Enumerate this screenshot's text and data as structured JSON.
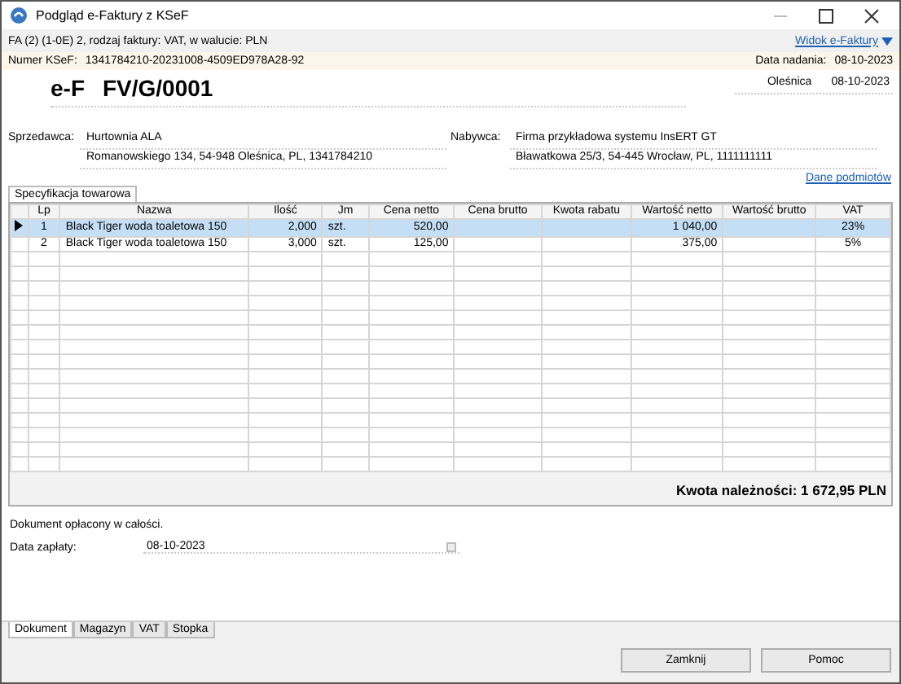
{
  "window": {
    "title": "Podgląd e-Faktury z KSeF"
  },
  "info_bar": {
    "text": "FA (2) (1-0E) 2, rodzaj faktury: VAT, w walucie: PLN",
    "view_link": "Widok e-Faktury"
  },
  "ksef": {
    "label": "Numer KSeF:",
    "number": "1341784210-20231008-4509ED978A28-92",
    "sent_label": "Data nadania:",
    "sent_date": "08-10-2023"
  },
  "document": {
    "prefix": "e-F",
    "number": "FV/G/0001",
    "place": "Oleśnica",
    "date": "08-10-2023"
  },
  "seller": {
    "label": "Sprzedawca:",
    "name": "Hurtownia ALA",
    "address": "Romanowskiego 134, 54-948 Oleśnica, PL, 1341784210"
  },
  "buyer": {
    "label": "Nabywca:",
    "name": "Firma przykładowa systemu InsERT GT",
    "address": "Bławatkowa 25/3, 54-445 Wrocław, PL, 1111111111"
  },
  "parties_link": "Dane podmiotów",
  "top_tabs": [
    {
      "label": "Specyfikacja towarowa",
      "selected": true
    }
  ],
  "table": {
    "columns": [
      "Lp",
      "Nazwa",
      "Ilość",
      "Jm",
      "Cena netto",
      "Cena brutto",
      "Kwota rabatu",
      "Wartość netto",
      "Wartość brutto",
      "VAT"
    ],
    "rows": [
      {
        "selected": true,
        "cells": [
          "1",
          "Black Tiger woda toaletowa 150",
          "2,000",
          "szt.",
          "520,00",
          "",
          "",
          "1 040,00",
          "",
          "23%"
        ]
      },
      {
        "selected": false,
        "cells": [
          "2",
          "Black Tiger woda toaletowa 150",
          "3,000",
          "szt.",
          "125,00",
          "",
          "",
          "375,00",
          "",
          "5%"
        ]
      }
    ]
  },
  "total": "Kwota należności: 1 672,95 PLN",
  "payment": {
    "status": "Dokument opłacony w całości.",
    "date_label": "Data zapłaty:",
    "date_value": "08-10-2023"
  },
  "bottom_tabs": [
    {
      "label": "Dokument",
      "selected": true
    },
    {
      "label": "Magazyn",
      "selected": false
    },
    {
      "label": "VAT",
      "selected": false
    },
    {
      "label": "Stopka",
      "selected": false
    }
  ],
  "buttons": [
    "Zamknij",
    "Pomoc"
  ]
}
